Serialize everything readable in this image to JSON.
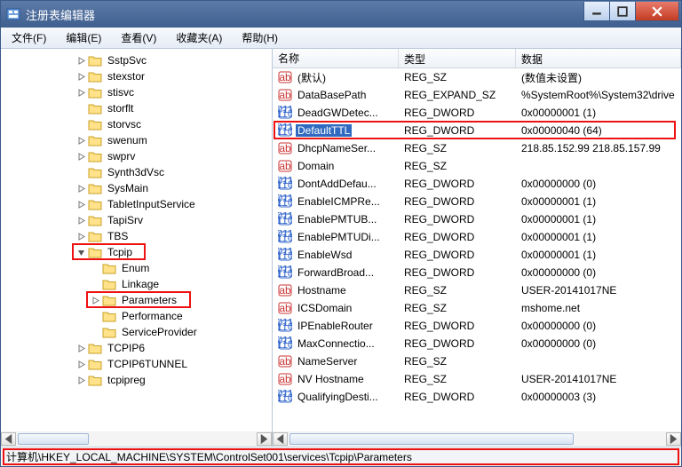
{
  "window": {
    "title": "注册表编辑器"
  },
  "menu": {
    "file": "文件(F)",
    "edit": "编辑(E)",
    "view": "查看(V)",
    "fav": "收藏夹(A)",
    "help": "帮助(H)"
  },
  "tree": {
    "items": [
      {
        "label": "SstpSvc",
        "indent": 5,
        "exp": "closed"
      },
      {
        "label": "stexstor",
        "indent": 5,
        "exp": "closed"
      },
      {
        "label": "stisvc",
        "indent": 5,
        "exp": "closed"
      },
      {
        "label": "storflt",
        "indent": 5,
        "exp": "none"
      },
      {
        "label": "storvsc",
        "indent": 5,
        "exp": "none"
      },
      {
        "label": "swenum",
        "indent": 5,
        "exp": "closed"
      },
      {
        "label": "swprv",
        "indent": 5,
        "exp": "closed"
      },
      {
        "label": "Synth3dVsc",
        "indent": 5,
        "exp": "none"
      },
      {
        "label": "SysMain",
        "indent": 5,
        "exp": "closed"
      },
      {
        "label": "TabletInputService",
        "indent": 5,
        "exp": "closed"
      },
      {
        "label": "TapiSrv",
        "indent": 5,
        "exp": "closed"
      },
      {
        "label": "TBS",
        "indent": 5,
        "exp": "closed"
      },
      {
        "label": "Tcpip",
        "indent": 5,
        "exp": "open",
        "hl": true
      },
      {
        "label": "Enum",
        "indent": 6,
        "exp": "none"
      },
      {
        "label": "Linkage",
        "indent": 6,
        "exp": "none"
      },
      {
        "label": "Parameters",
        "indent": 6,
        "exp": "closed",
        "hl": true
      },
      {
        "label": "Performance",
        "indent": 6,
        "exp": "none"
      },
      {
        "label": "ServiceProvider",
        "indent": 6,
        "exp": "none"
      },
      {
        "label": "TCPIP6",
        "indent": 5,
        "exp": "closed"
      },
      {
        "label": "TCPIP6TUNNEL",
        "indent": 5,
        "exp": "closed"
      },
      {
        "label": "tcpipreg",
        "indent": 5,
        "exp": "closed"
      }
    ]
  },
  "cols": {
    "name": "名称",
    "type": "类型",
    "data": "数据"
  },
  "values": [
    {
      "icon": "str",
      "name": "(默认)",
      "type": "REG_SZ",
      "data": "(数值未设置)"
    },
    {
      "icon": "str",
      "name": "DataBasePath",
      "type": "REG_EXPAND_SZ",
      "data": "%SystemRoot%\\System32\\drive"
    },
    {
      "icon": "bin",
      "name": "DeadGWDetec...",
      "type": "REG_DWORD",
      "data": "0x00000001 (1)"
    },
    {
      "icon": "bin",
      "name": "DefaultTTL",
      "type": "REG_DWORD",
      "data": "0x00000040 (64)",
      "sel": true,
      "hl": true
    },
    {
      "icon": "str",
      "name": "DhcpNameSer...",
      "type": "REG_SZ",
      "data": "218.85.152.99 218.85.157.99"
    },
    {
      "icon": "str",
      "name": "Domain",
      "type": "REG_SZ",
      "data": ""
    },
    {
      "icon": "bin",
      "name": "DontAddDefau...",
      "type": "REG_DWORD",
      "data": "0x00000000 (0)"
    },
    {
      "icon": "bin",
      "name": "EnableICMPRe...",
      "type": "REG_DWORD",
      "data": "0x00000001 (1)"
    },
    {
      "icon": "bin",
      "name": "EnablePMTUB...",
      "type": "REG_DWORD",
      "data": "0x00000001 (1)"
    },
    {
      "icon": "bin",
      "name": "EnablePMTUDi...",
      "type": "REG_DWORD",
      "data": "0x00000001 (1)"
    },
    {
      "icon": "bin",
      "name": "EnableWsd",
      "type": "REG_DWORD",
      "data": "0x00000001 (1)"
    },
    {
      "icon": "bin",
      "name": "ForwardBroad...",
      "type": "REG_DWORD",
      "data": "0x00000000 (0)"
    },
    {
      "icon": "str",
      "name": "Hostname",
      "type": "REG_SZ",
      "data": "USER-20141017NE"
    },
    {
      "icon": "str",
      "name": "ICSDomain",
      "type": "REG_SZ",
      "data": "mshome.net"
    },
    {
      "icon": "bin",
      "name": "IPEnableRouter",
      "type": "REG_DWORD",
      "data": "0x00000000 (0)"
    },
    {
      "icon": "bin",
      "name": "MaxConnectio...",
      "type": "REG_DWORD",
      "data": "0x00000000 (0)"
    },
    {
      "icon": "str",
      "name": "NameServer",
      "type": "REG_SZ",
      "data": ""
    },
    {
      "icon": "str",
      "name": "NV Hostname",
      "type": "REG_SZ",
      "data": "USER-20141017NE"
    },
    {
      "icon": "bin",
      "name": "QualifyingDesti...",
      "type": "REG_DWORD",
      "data": "0x00000003 (3)"
    }
  ],
  "status": {
    "path": "计算机\\HKEY_LOCAL_MACHINE\\SYSTEM\\ControlSet001\\services\\Tcpip\\Parameters"
  }
}
